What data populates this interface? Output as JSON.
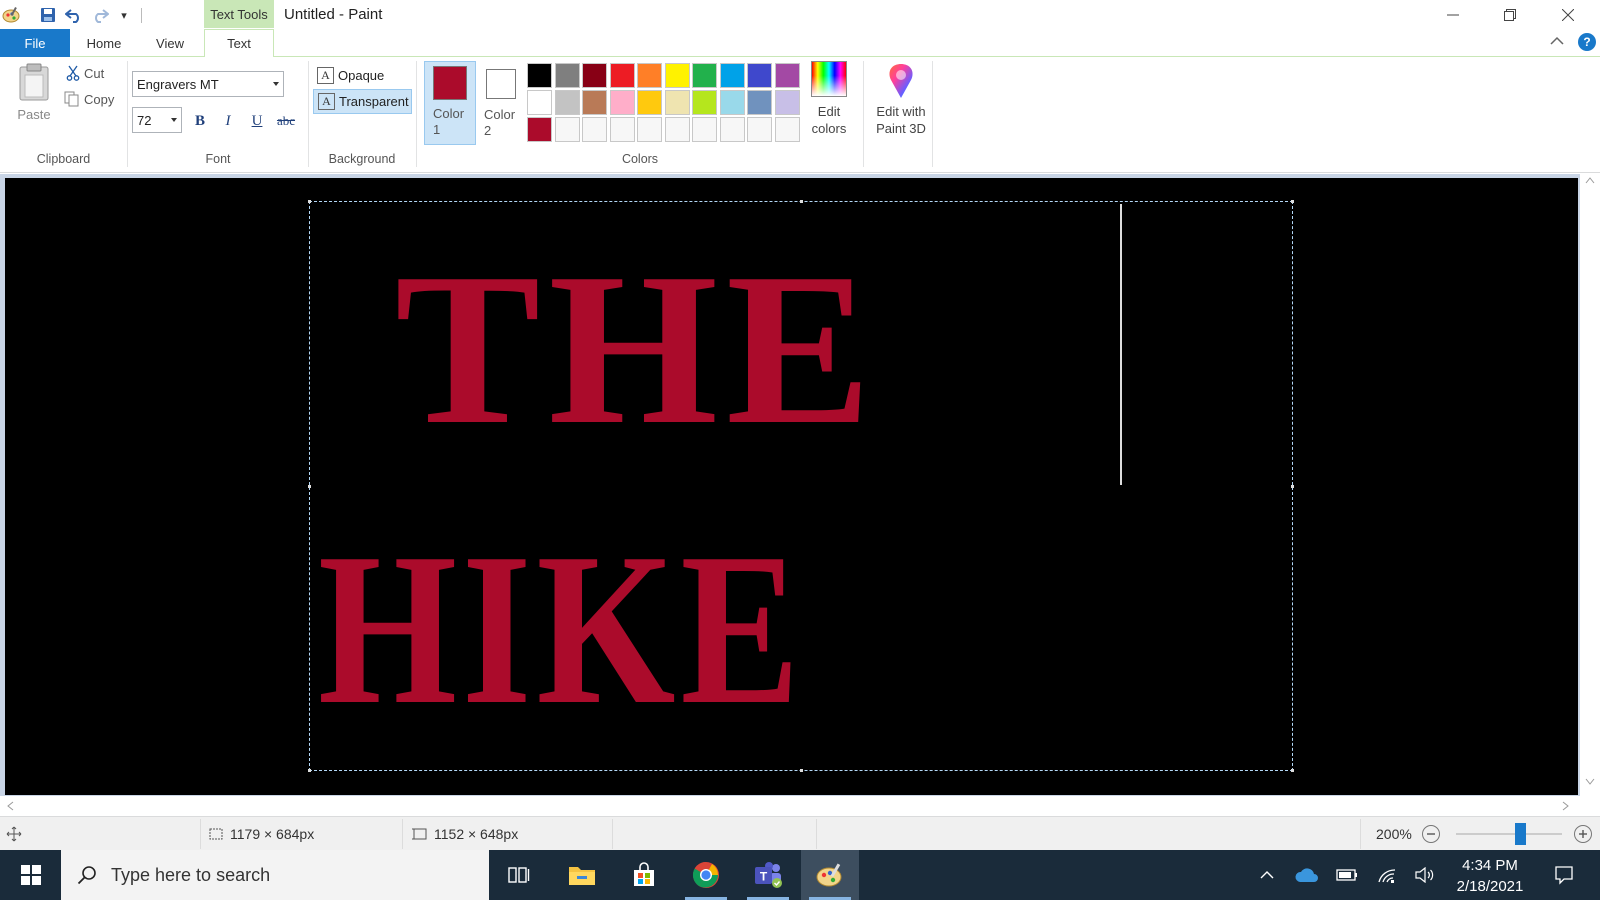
{
  "titlebar": {
    "contextual_tab": "Text Tools",
    "title": "Untitled - Paint",
    "qat_customize": "▾"
  },
  "tabs": {
    "file": "File",
    "home": "Home",
    "view": "View",
    "text": "Text"
  },
  "clipboard": {
    "paste": "Paste",
    "cut": "Cut",
    "copy": "Copy",
    "group": "Clipboard"
  },
  "font": {
    "family": "Engravers MT",
    "size": "72",
    "bold": "B",
    "italic": "I",
    "underline": "U",
    "strike": "abc",
    "group": "Font"
  },
  "background": {
    "opaque": "Opaque",
    "transparent": "Transparent",
    "group": "Background"
  },
  "colors": {
    "color1": "Color 1",
    "color2": "Color 2",
    "color1_value": "#ab0b2b",
    "color2_value": "#ffffff",
    "edit": "Edit colors",
    "paint3d": "Edit with Paint 3D",
    "group": "Colors",
    "palette": [
      "#000000",
      "#7f7f7f",
      "#880015",
      "#ed1c24",
      "#ff7f27",
      "#fff200",
      "#22b14c",
      "#00a2e8",
      "#3f48cc",
      "#a349a4",
      "#ffffff",
      "#c3c3c3",
      "#b97a57",
      "#ffaec9",
      "#ffc90e",
      "#efe4b0",
      "#b5e61d",
      "#99d9ea",
      "#7092be",
      "#c8bfe7",
      "#ab0b2b",
      "#f7f7f7",
      "#f7f7f7",
      "#f7f7f7",
      "#f7f7f7",
      "#f7f7f7",
      "#f7f7f7",
      "#f7f7f7",
      "#f7f7f7",
      "#f7f7f7"
    ]
  },
  "canvas": {
    "line1": "THE",
    "line2": "HIKE",
    "text_color": "#ab0b2b",
    "bg": "#000000"
  },
  "status": {
    "selection_size": "1179 × 684px",
    "image_size": "1152 × 648px",
    "zoom": "200%",
    "zoom_level_fraction": 0.6
  },
  "taskbar": {
    "search_placeholder": "Type here to search",
    "time": "4:34 PM",
    "date": "2/18/2021"
  }
}
